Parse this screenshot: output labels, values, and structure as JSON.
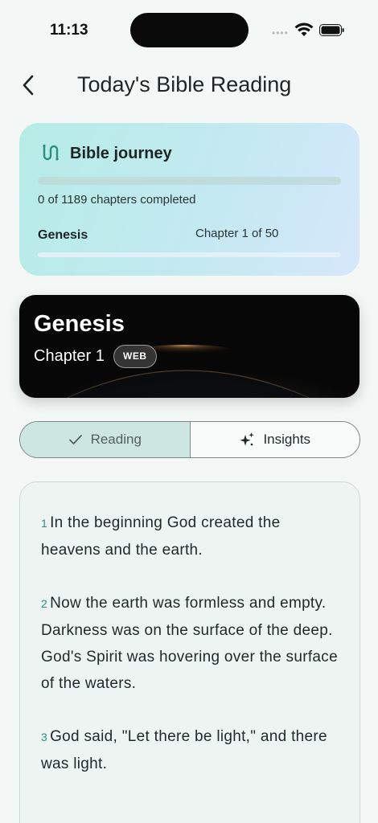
{
  "status_bar": {
    "time": "11:13"
  },
  "header": {
    "title": "Today's Bible Reading"
  },
  "journey": {
    "title": "Bible journey",
    "chapters_completed_text": "0 of 1189 chapters completed",
    "overall_progress_fraction": 0,
    "current_book": "Genesis",
    "current_chapter_text": "Chapter 1 of 50",
    "book_progress_fraction": 0
  },
  "hero": {
    "book": "Genesis",
    "chapter": "Chapter 1",
    "translation_badge": "WEB"
  },
  "tabs": {
    "reading_label": "Reading",
    "insights_label": "Insights",
    "active": "reading"
  },
  "verses": [
    {
      "num": "1",
      "text": "In the beginning God created the heavens and the earth."
    },
    {
      "num": "2",
      "text": "Now the earth was formless and empty. Darkness was on the surface of the deep. God's Spirit was hovering over the surface of the waters."
    },
    {
      "num": "3",
      "text": "God said, \"Let there be light,\" and there was light."
    }
  ],
  "icons": {
    "back": "chevron-left-icon",
    "journey": "route-icon",
    "reading_tab": "check-icon",
    "insights_tab": "sparkle-icon",
    "wifi": "wifi-icon",
    "battery": "battery-icon"
  },
  "colors": {
    "accent": "#2f8e80",
    "active_tab_bg": "#cde6e2",
    "journey_gradient_start": "#b6ece6",
    "journey_gradient_end": "#d6e8fb"
  }
}
